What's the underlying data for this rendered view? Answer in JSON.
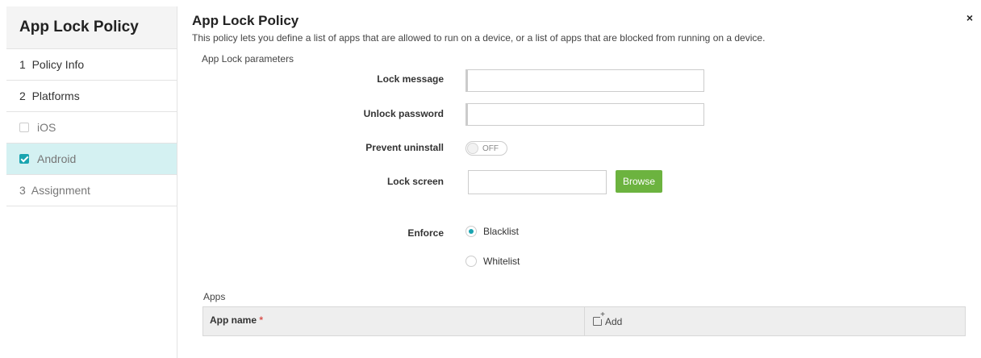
{
  "sidebar": {
    "title": "App Lock Policy",
    "items": [
      {
        "label": "1  Policy Info"
      },
      {
        "label": "2  Platforms"
      },
      {
        "label": "iOS"
      },
      {
        "label": "Android"
      },
      {
        "label": "3  Assignment"
      }
    ]
  },
  "header": {
    "title": "App Lock Policy",
    "description": "This policy lets you define a list of apps that are allowed to run on a device, or a list of apps that are blocked from running on a device.",
    "close_icon": "×"
  },
  "form": {
    "section_label": "App Lock parameters",
    "lock_message_label": "Lock message",
    "lock_message_value": "",
    "unlock_password_label": "Unlock password",
    "unlock_password_value": "",
    "prevent_uninstall_label": "Prevent uninstall",
    "prevent_uninstall_state": "OFF",
    "lock_screen_label": "Lock screen",
    "lock_screen_value": "",
    "browse_label": "Browse",
    "enforce_label": "Enforce",
    "enforce_options": [
      {
        "label": "Blacklist",
        "selected": true
      },
      {
        "label": "Whitelist",
        "selected": false
      }
    ]
  },
  "apps": {
    "label": "Apps",
    "column_app_name": "App name",
    "required_mark": "*",
    "add_label": "Add"
  },
  "colors": {
    "accent": "#1aa4b0",
    "active_nav_bg": "#d4f1f2",
    "browse_button": "#6cb33f",
    "required": "#d9534f"
  }
}
